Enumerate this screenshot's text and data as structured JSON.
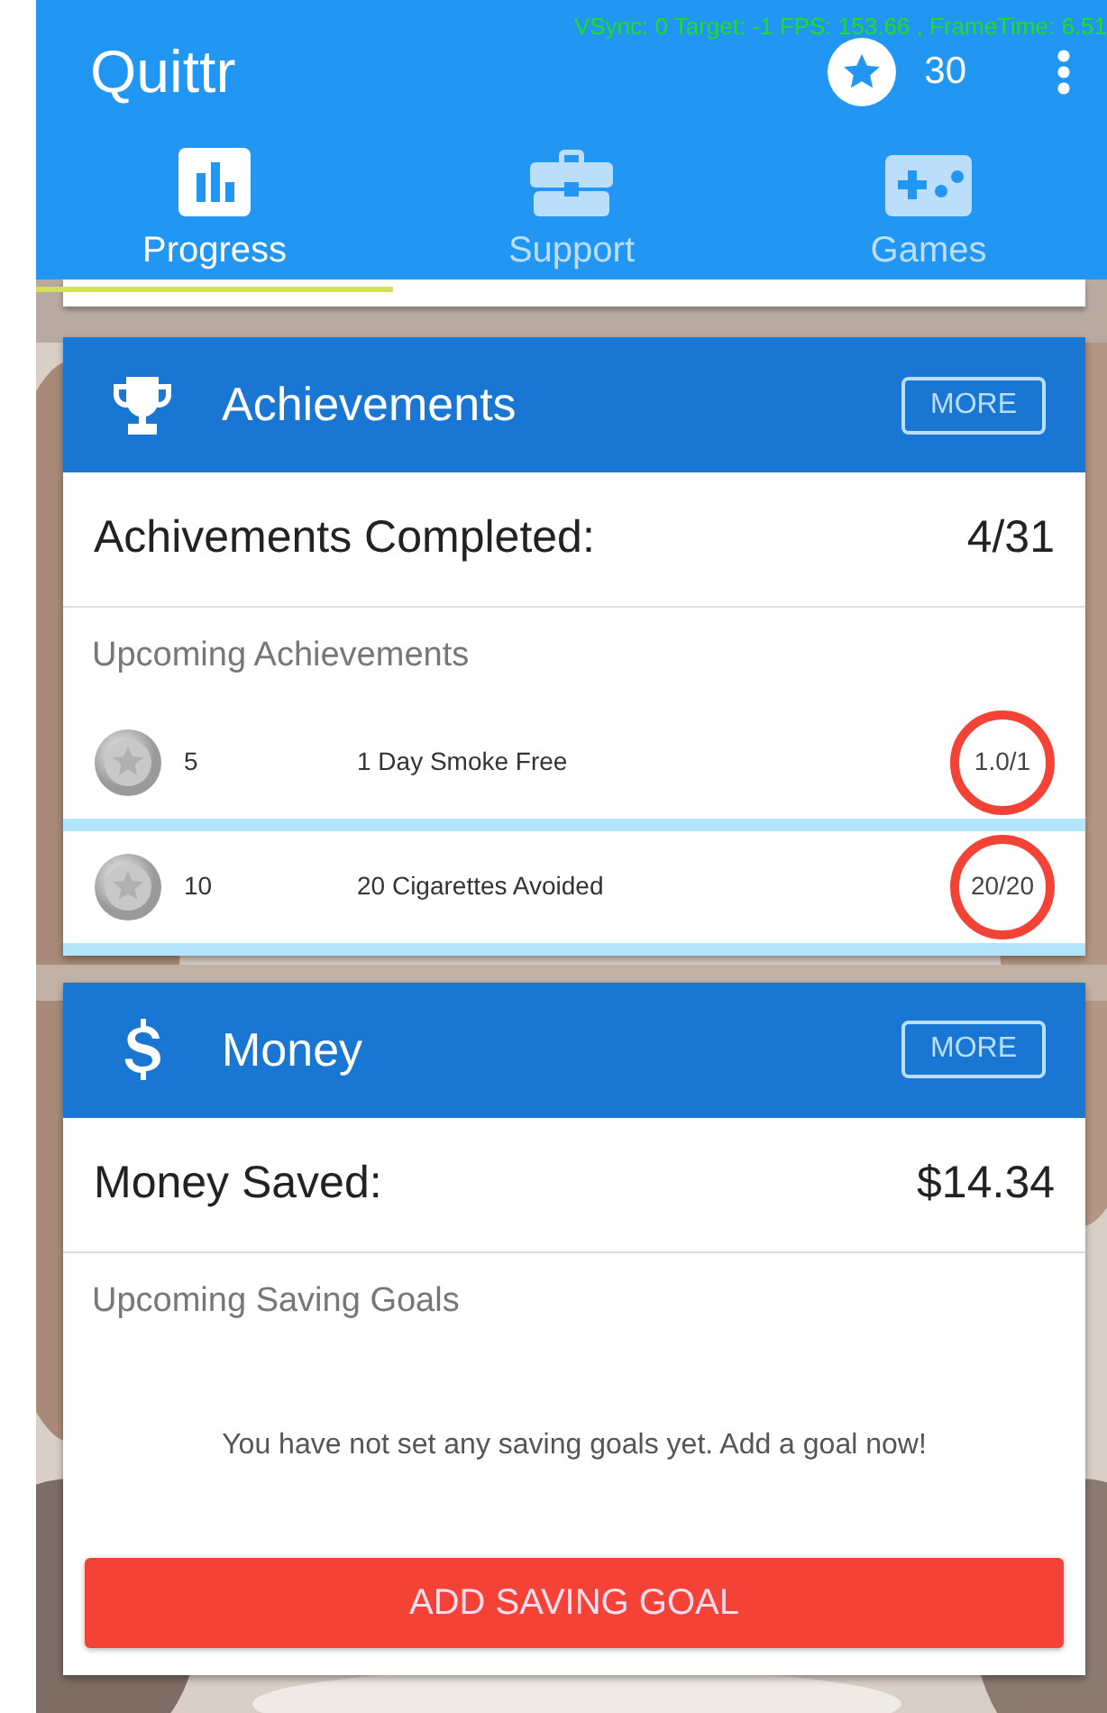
{
  "debug_overlay": "VSync: 0 Target: -1 FPS: 153.66 , FrameTime: 6.51",
  "app_bar": {
    "title": "Quittr",
    "points": "30"
  },
  "tabs": [
    {
      "label": "Progress",
      "selected": true
    },
    {
      "label": "Support",
      "selected": false
    },
    {
      "label": "Games",
      "selected": false
    }
  ],
  "sections": [
    {
      "kind": "achievements",
      "title": "Achievements",
      "more": "MORE",
      "summary_label": "Achivements Completed:",
      "summary_value": "4/31",
      "upcoming_title": "Upcoming Achievements",
      "rows": [
        {
          "points": "5",
          "name": "1 Day Smoke Free",
          "progress": "1.0/1"
        },
        {
          "points": "10",
          "name": "20 Cigarettes Avoided",
          "progress": "20/20"
        }
      ]
    },
    {
      "kind": "money",
      "title": "Money",
      "more": "MORE",
      "summary_label": "Money Saved:",
      "summary_value": "$14.34",
      "upcoming_title": "Upcoming Saving Goals",
      "empty_message": "You have not set any saving goals yet. Add a goal now!",
      "action": "ADD SAVING GOAL"
    }
  ]
}
